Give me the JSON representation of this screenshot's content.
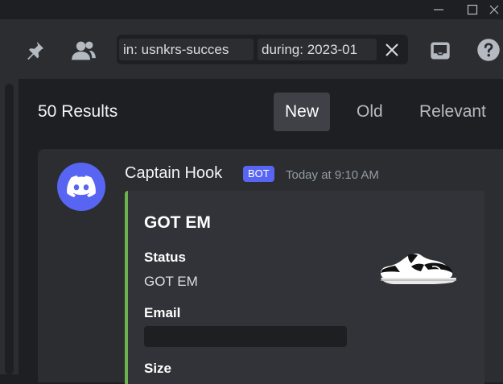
{
  "window": {
    "minimize_glyph": "—",
    "maximize_glyph": "☐",
    "close_glyph": "✕"
  },
  "toolbar": {
    "pin_icon": "pin-icon",
    "members_icon": "members-icon",
    "inbox_icon": "inbox-icon",
    "help_icon": "help-icon",
    "search": {
      "filter_channel": "in: usnkrs-succes",
      "filter_date": "during: 2023-01",
      "clear_icon": "close-icon"
    }
  },
  "results": {
    "count_label": "50 Results",
    "sort_tabs": [
      {
        "label": "New",
        "selected": true
      },
      {
        "label": "Old",
        "selected": false
      },
      {
        "label": "Relevant",
        "selected": false
      }
    ]
  },
  "message": {
    "author": "Captain Hook",
    "badge": "BOT",
    "timestamp": "Today at 9:10 AM",
    "embed": {
      "accent_color": "#6cb24e",
      "title": "GOT EM",
      "fields": [
        {
          "name": "Status",
          "value": "GOT EM"
        },
        {
          "name": "Email",
          "value": ""
        },
        {
          "name": "Size",
          "value": ""
        }
      ],
      "thumbnail": "sneaker-image"
    }
  },
  "colors": {
    "brand": "#5865f2",
    "background": "#1e1f22",
    "panel": "#2b2d31"
  }
}
